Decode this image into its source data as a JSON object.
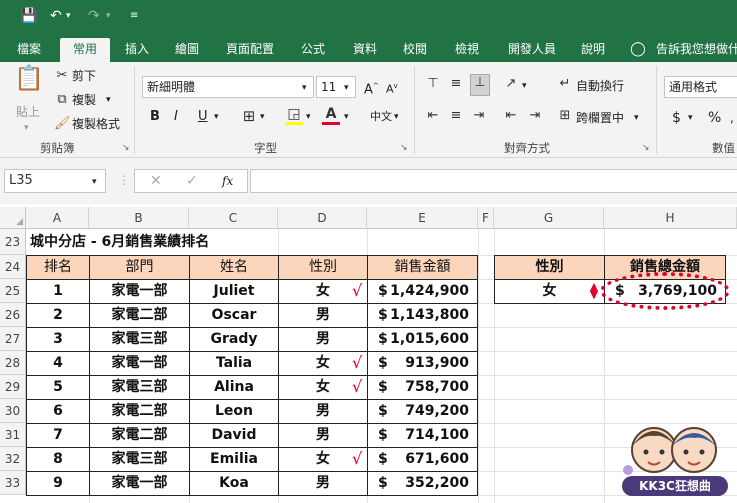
{
  "quick_access": {
    "save_icon": "save-icon",
    "undo_icon": "undo-icon",
    "redo_icon": "redo-icon"
  },
  "tabs": [
    "檔案",
    "常用",
    "插入",
    "繪圖",
    "頁面配置",
    "公式",
    "資料",
    "校閱",
    "檢視",
    "開發人員",
    "說明"
  ],
  "tell_me": "告訴我您想做什",
  "ribbon": {
    "clipboard": {
      "paste": "貼上",
      "cut": "剪下",
      "copy": "複製",
      "format_painter": "複製格式",
      "label": "剪貼簿"
    },
    "font": {
      "name": "新細明體",
      "size": "11",
      "bold": "B",
      "italic": "I",
      "underline": "U",
      "label": "字型",
      "phonetic": "中文"
    },
    "alignment": {
      "wrap": "自動換行",
      "merge": "跨欄置中",
      "label": "對齊方式"
    },
    "number": {
      "format": "通用格式",
      "currency": "$",
      "percent": "%",
      "label": "數值"
    }
  },
  "formula_bar": {
    "name_box": "L35",
    "cancel": "✕",
    "enter": "✓",
    "fx": "fx",
    "value": ""
  },
  "columns": [
    "A",
    "B",
    "C",
    "D",
    "E",
    "F",
    "G",
    "H"
  ],
  "rows": [
    "23",
    "24",
    "25",
    "26",
    "27",
    "28",
    "29",
    "30",
    "31",
    "32",
    "33"
  ],
  "sheet": {
    "title": "城中分店 - 6月銷售業績排名",
    "headers": [
      "排名",
      "部門",
      "姓名",
      "性別",
      "銷售金額"
    ],
    "records": [
      {
        "rank": "1",
        "dept": "家電一部",
        "name": "Juliet",
        "gender": "女",
        "check": "√",
        "cur": "$",
        "amount": "1,424,900"
      },
      {
        "rank": "2",
        "dept": "家電二部",
        "name": "Oscar",
        "gender": "男",
        "check": "",
        "cur": "$",
        "amount": "1,143,800"
      },
      {
        "rank": "3",
        "dept": "家電三部",
        "name": "Grady",
        "gender": "男",
        "check": "",
        "cur": "$",
        "amount": "1,015,600"
      },
      {
        "rank": "4",
        "dept": "家電一部",
        "name": "Talia",
        "gender": "女",
        "check": "√",
        "cur": "$",
        "amount": "913,900"
      },
      {
        "rank": "5",
        "dept": "家電三部",
        "name": "Alina",
        "gender": "女",
        "check": "√",
        "cur": "$",
        "amount": "758,700"
      },
      {
        "rank": "6",
        "dept": "家電二部",
        "name": "Leon",
        "gender": "男",
        "check": "",
        "cur": "$",
        "amount": "749,200"
      },
      {
        "rank": "7",
        "dept": "家電二部",
        "name": "David",
        "gender": "男",
        "check": "",
        "cur": "$",
        "amount": "714,100"
      },
      {
        "rank": "8",
        "dept": "家電三部",
        "name": "Emilia",
        "gender": "女",
        "check": "√",
        "cur": "$",
        "amount": "671,600"
      },
      {
        "rank": "9",
        "dept": "家電一部",
        "name": "Koa",
        "gender": "男",
        "check": "",
        "cur": "$",
        "amount": "352,200"
      }
    ],
    "summary": {
      "gender_header": "性別",
      "total_header": "銷售總金額",
      "gender_value": "女",
      "cur": "$",
      "total_value": "3,769,100"
    }
  },
  "watermark": "KK3C狂想曲",
  "colors": {
    "brand": "#217346",
    "header_fill": "#fbd6bd",
    "highlight": "#e4002b"
  }
}
